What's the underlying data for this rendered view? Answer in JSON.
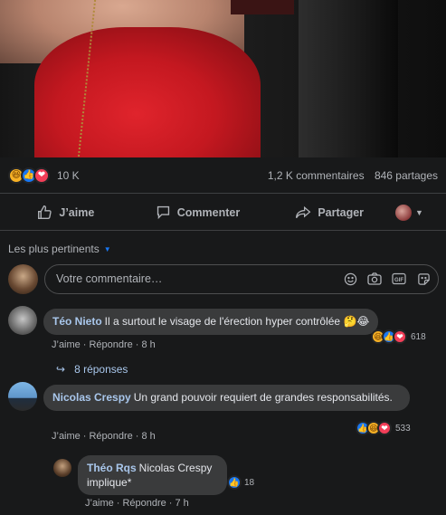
{
  "stats": {
    "reaction_count": "10 K",
    "comments": "1,2 K commentaires",
    "shares": "846 partages",
    "reactions": [
      "haha",
      "like",
      "love"
    ]
  },
  "actions": {
    "like": "J’aime",
    "comment": "Commenter",
    "share": "Partager"
  },
  "sort_label": "Les plus pertinents",
  "composer": {
    "placeholder": "Votre commentaire…",
    "tools": [
      "emoji-icon",
      "camera-icon",
      "gif-icon",
      "sticker-icon"
    ]
  },
  "comments": [
    {
      "author": "Téo Nieto",
      "text": "Il a surtout le visage de l'érection hyper contrôlée 🤔😂",
      "like": "J’aime",
      "reply": "Répondre",
      "time": "8 h",
      "reaction_count": "618",
      "reactions": [
        "haha",
        "like",
        "love"
      ],
      "replies_label": "8 réponses"
    },
    {
      "author": "Nicolas Crespy",
      "text": "Un grand pouvoir requiert de grandes responsabilités.",
      "like": "J’aime",
      "reply": "Répondre",
      "time": "8 h",
      "reaction_count": "533",
      "reactions": [
        "like",
        "haha",
        "love"
      ]
    },
    {
      "author": "Théo Rqs",
      "text": "Nicolas Crespy implique*",
      "like": "J’aime",
      "reply": "Répondre",
      "time": "7 h",
      "reaction_count": "18",
      "reactions": [
        "like"
      ]
    }
  ],
  "colors": {
    "background": "#18191a",
    "bubble": "#3a3b3c",
    "author": "#a9c7ec",
    "like_blue": "#1877f2",
    "love_red": "#f33e58",
    "haha_yellow": "#f7b125"
  }
}
